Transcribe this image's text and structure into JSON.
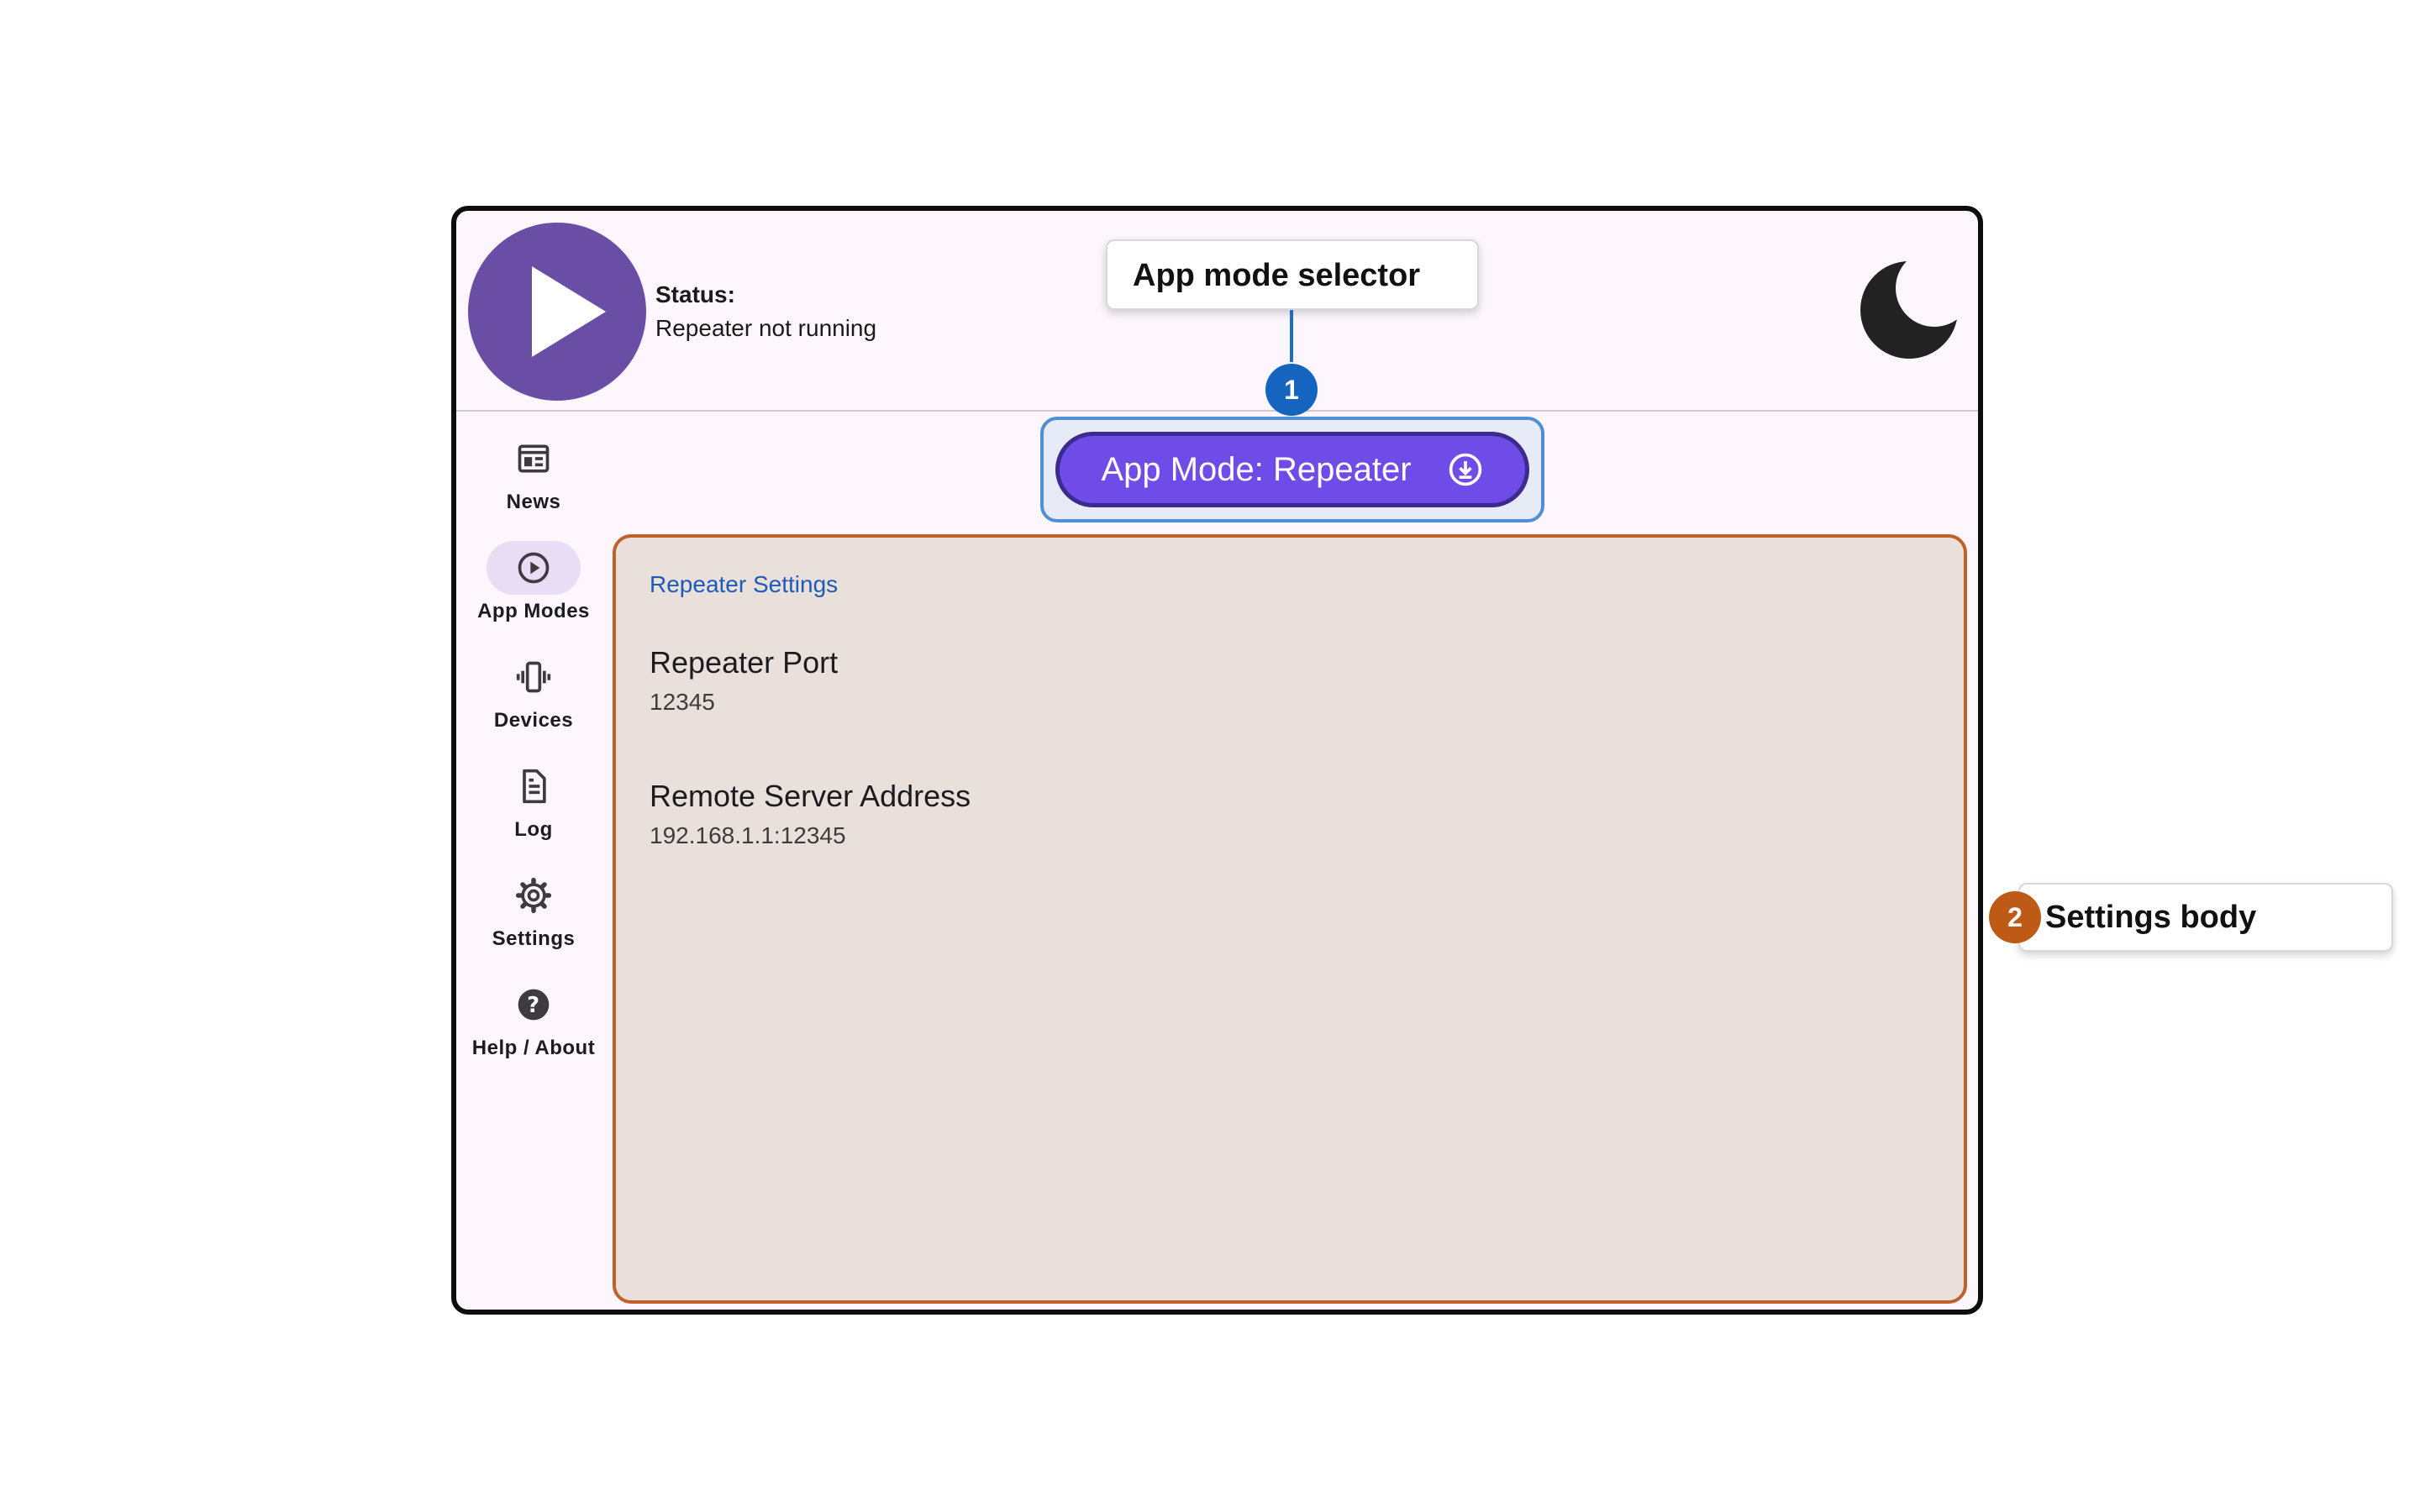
{
  "status": {
    "label": "Status:",
    "text": "Repeater not running"
  },
  "sidebar": {
    "items": [
      {
        "label": "News",
        "icon": "news-icon",
        "active": false
      },
      {
        "label": "App Modes",
        "icon": "play-circle-icon",
        "active": true
      },
      {
        "label": "Devices",
        "icon": "vibration-icon",
        "active": false
      },
      {
        "label": "Log",
        "icon": "document-icon",
        "active": false
      },
      {
        "label": "Settings",
        "icon": "gear-icon",
        "active": false
      },
      {
        "label": "Help / About",
        "icon": "help-icon",
        "active": false
      }
    ]
  },
  "mode_selector": {
    "label": "App Mode: Repeater",
    "icon": "download-circle-icon"
  },
  "settings": {
    "section_title": "Repeater Settings",
    "items": [
      {
        "title": "Repeater Port",
        "value": "12345"
      },
      {
        "title": "Remote Server Address",
        "value": "192.168.1.1:12345"
      }
    ]
  },
  "annotations": [
    {
      "number": "1",
      "label": "App mode selector",
      "color": "#1565c0"
    },
    {
      "number": "2",
      "label": "Settings body",
      "color": "#bf5a16"
    }
  ],
  "colors": {
    "accent": "#6f4be8",
    "play_button": "#6a4ea6",
    "settings_bg": "#e9dfdb",
    "app_bg": "#fdf6fd"
  }
}
